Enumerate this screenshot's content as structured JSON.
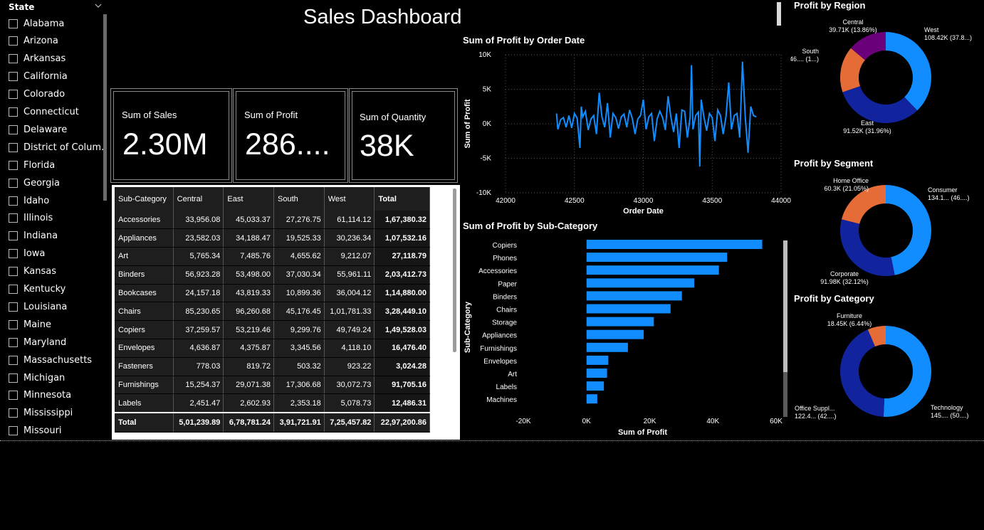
{
  "title": "Sales Dashboard",
  "slicer": {
    "header": "State",
    "items": [
      "Alabama",
      "Arizona",
      "Arkansas",
      "California",
      "Colorado",
      "Connecticut",
      "Delaware",
      "District of Colum...",
      "Florida",
      "Georgia",
      "Idaho",
      "Illinois",
      "Indiana",
      "Iowa",
      "Kansas",
      "Kentucky",
      "Louisiana",
      "Maine",
      "Maryland",
      "Massachusetts",
      "Michigan",
      "Minnesota",
      "Mississippi",
      "Missouri"
    ]
  },
  "kpis": {
    "sales": {
      "label": "Sum of Sales",
      "value": "2.30M"
    },
    "profit": {
      "label": "Sum of Profit",
      "value": "286...."
    },
    "quantity": {
      "label": "Sum of Quantity",
      "value": "38K"
    }
  },
  "table": {
    "headers": [
      "Sub-Category",
      "Central",
      "East",
      "South",
      "West",
      "Total"
    ],
    "rows": [
      [
        "Accessories",
        "33,956.08",
        "45,033.37",
        "27,276.75",
        "61,114.12",
        "1,67,380.32"
      ],
      [
        "Appliances",
        "23,582.03",
        "34,188.47",
        "19,525.33",
        "30,236.34",
        "1,07,532.16"
      ],
      [
        "Art",
        "5,765.34",
        "7,485.76",
        "4,655.62",
        "9,212.07",
        "27,118.79"
      ],
      [
        "Binders",
        "56,923.28",
        "53,498.00",
        "37,030.34",
        "55,961.11",
        "2,03,412.73"
      ],
      [
        "Bookcases",
        "24,157.18",
        "43,819.33",
        "10,899.36",
        "36,004.12",
        "1,14,880.00"
      ],
      [
        "Chairs",
        "85,230.65",
        "96,260.68",
        "45,176.45",
        "1,01,781.33",
        "3,28,449.10"
      ],
      [
        "Copiers",
        "37,259.57",
        "53,219.46",
        "9,299.76",
        "49,749.24",
        "1,49,528.03"
      ],
      [
        "Envelopes",
        "4,636.87",
        "4,375.87",
        "3,345.56",
        "4,118.10",
        "16,476.40"
      ],
      [
        "Fasteners",
        "778.03",
        "819.72",
        "503.32",
        "923.22",
        "3,024.28"
      ],
      [
        "Furnishings",
        "15,254.37",
        "29,071.38",
        "17,306.68",
        "30,072.73",
        "91,705.16"
      ],
      [
        "Labels",
        "2,451.47",
        "2,602.93",
        "2,353.18",
        "5,078.73",
        "12,486.31"
      ]
    ],
    "total_row": [
      "Total",
      "5,01,239.89",
      "6,78,781.24",
      "3,91,721.91",
      "7,25,457.82",
      "22,97,200.86"
    ]
  },
  "colors": {
    "blue": "#118DFF",
    "navy": "#12239E",
    "orange": "#E66C37",
    "purple": "#6B007B"
  },
  "chart_data": [
    {
      "type": "line",
      "title": "Sum of Profit by Order Date",
      "xlabel": "Order Date",
      "ylabel": "Sum of Profit",
      "xlim": [
        42000,
        44000
      ],
      "ylim": [
        -10000,
        10000
      ],
      "xticks": [
        "42000",
        "42500",
        "43000",
        "43500",
        "44000"
      ],
      "yticks": [
        "10K",
        "5K",
        "0K",
        "-5K",
        "-10K"
      ],
      "grid": true,
      "series": [
        {
          "x": [
            42370,
            42380,
            42400,
            42420,
            42440,
            42460,
            42480,
            42500,
            42520,
            42540,
            42550,
            42560,
            42580,
            42600,
            42620,
            42640,
            42660,
            42680,
            42700,
            42720,
            42740,
            42760,
            42780,
            42800,
            42820,
            42840,
            42860,
            42880,
            42900,
            42920,
            42940,
            42960,
            42980,
            43000,
            43020,
            43040,
            43060,
            43080,
            43100,
            43120,
            43140,
            43160,
            43180,
            43200,
            43220,
            43240,
            43260,
            43280,
            43300,
            43320,
            43340,
            43350,
            43360,
            43380,
            43400,
            43410,
            43420,
            43440,
            43460,
            43480,
            43500,
            43520,
            43540,
            43560,
            43580,
            43600,
            43620,
            43640,
            43660,
            43680,
            43700,
            43720,
            43740,
            43760,
            43780,
            43800,
            43820
          ],
          "y": [
            1500,
            -800,
            600,
            900,
            -500,
            1200,
            -600,
            1500,
            800,
            -3500,
            2500,
            1000,
            1800,
            -900,
            700,
            1200,
            -1500,
            4500,
            1000,
            -500,
            3000,
            -2000,
            1500,
            900,
            -700,
            1000,
            1400,
            -500,
            2000,
            800,
            -1500,
            700,
            1200,
            3500,
            -800,
            1000,
            1500,
            -2500,
            700,
            1800,
            900,
            -900,
            4000,
            1000,
            -1200,
            1500,
            -3500,
            2000,
            1800,
            -2000,
            1000,
            8500,
            -800,
            1200,
            1700,
            -6200,
            3500,
            1000,
            -1000,
            1500,
            900,
            -2500,
            2000,
            1200,
            -1500,
            1000,
            6000,
            -800,
            1200,
            1500,
            -2000,
            9000,
            1000,
            -4200,
            2500,
            1200,
            1000
          ]
        }
      ]
    },
    {
      "type": "bar",
      "orientation": "horizontal",
      "title": "Sum of Profit by Sub-Category",
      "xlabel": "Sum of Profit",
      "ylabel": "Sub-Category",
      "xlim": [
        -20000,
        60000
      ],
      "xticks": [
        "-20K",
        "0K",
        "20K",
        "40K",
        "60K"
      ],
      "categories": [
        "Copiers",
        "Phones",
        "Accessories",
        "Paper",
        "Binders",
        "Chairs",
        "Storage",
        "Appliances",
        "Furnishings",
        "Envelopes",
        "Art",
        "Labels",
        "Machines"
      ],
      "values": [
        55600,
        44500,
        41900,
        34100,
        30200,
        26600,
        21300,
        18100,
        13100,
        6900,
        6500,
        5500,
        3400
      ]
    },
    {
      "type": "pie",
      "title": "Profit by Region",
      "labels": [
        "West",
        "East",
        "South",
        "Central"
      ],
      "values": [
        108.42,
        91.52,
        46.75,
        39.71
      ],
      "display_labels": [
        "West\n108.42K (37.8...)",
        "East\n91.52K (31.96%)",
        "South\n46.... (1...)",
        "Central\n39.71K (13.86%)"
      ]
    },
    {
      "type": "pie",
      "title": "Profit by Segment",
      "labels": [
        "Consumer",
        "Corporate",
        "Home Office"
      ],
      "values": [
        134.12,
        91.98,
        60.3
      ],
      "display_labels": [
        "Consumer\n134.1... (46....)",
        "Corporate\n91.98K (32.12%)",
        "Home Office\n60.3K (21.05%)"
      ]
    },
    {
      "type": "pie",
      "title": "Profit by Category",
      "labels": [
        "Technology",
        "Office Supplies",
        "Furniture"
      ],
      "values": [
        145.45,
        122.49,
        18.45
      ],
      "display_labels": [
        "Technology\n145.... (50....)",
        "Office Suppl...\n122.4... (42....)",
        "Furniture\n18.45K (6.44%)"
      ]
    }
  ]
}
